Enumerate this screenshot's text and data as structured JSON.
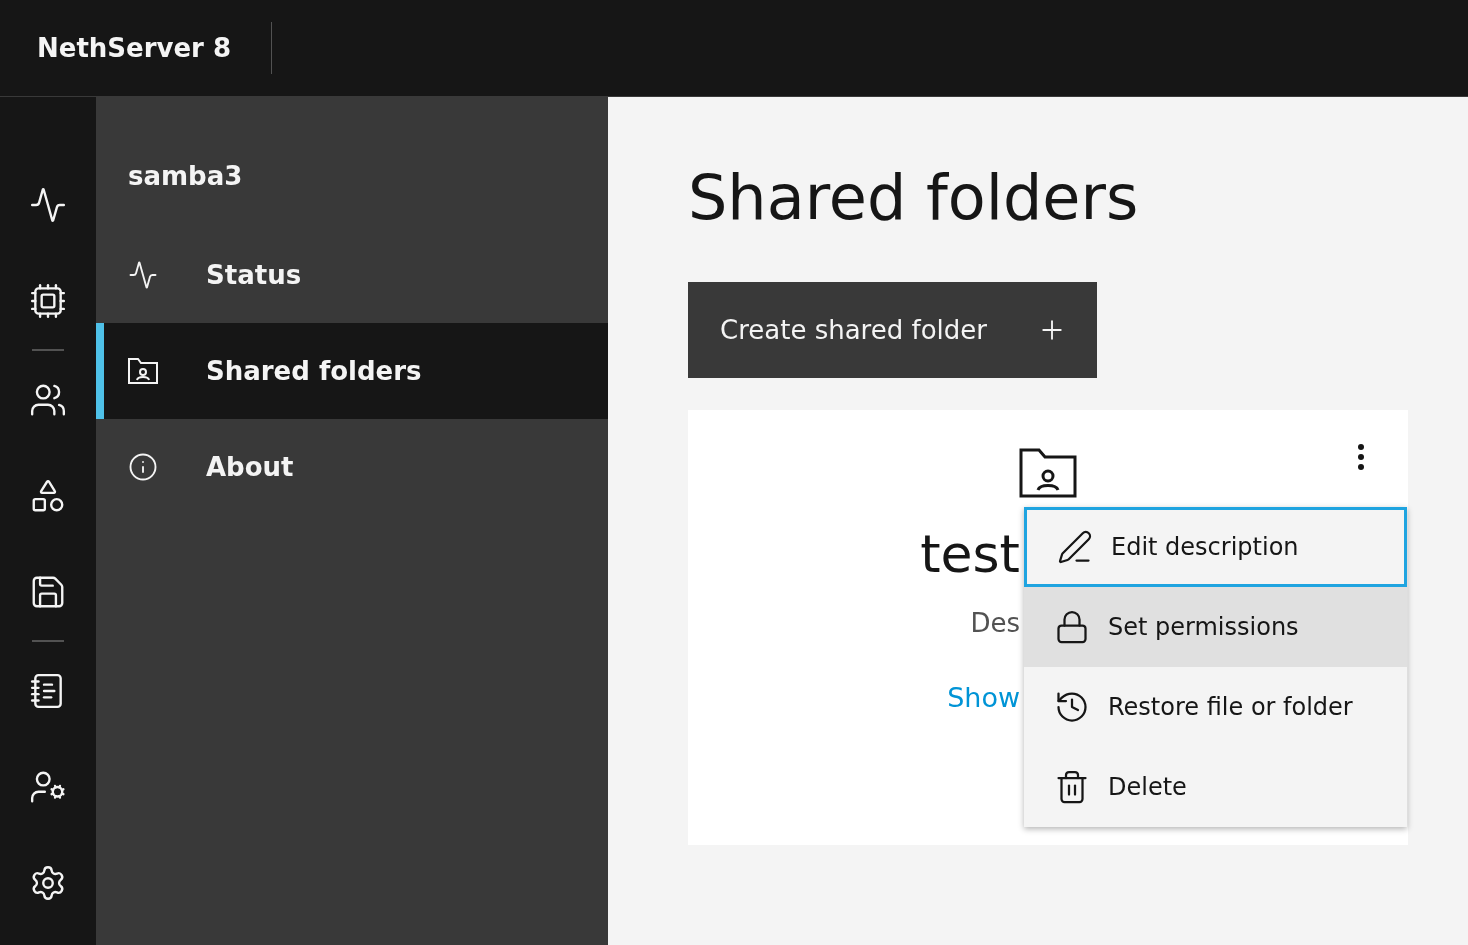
{
  "header": {
    "title": "NethServer 8"
  },
  "sidebar": {
    "app_name": "samba3",
    "items": [
      {
        "label": "Status",
        "selected": false
      },
      {
        "label": "Shared folders",
        "selected": true
      },
      {
        "label": "About",
        "selected": false
      }
    ]
  },
  "main": {
    "title": "Shared folders",
    "create_button": "Create shared folder",
    "card": {
      "name": "test",
      "description": "Des",
      "link": "Show"
    },
    "menu": [
      {
        "label": "Edit description",
        "focused": true,
        "hovered": false
      },
      {
        "label": "Set permissions",
        "focused": false,
        "hovered": true
      },
      {
        "label": "Restore file or folder",
        "focused": false,
        "hovered": false
      },
      {
        "label": "Delete",
        "focused": false,
        "hovered": false
      }
    ]
  }
}
